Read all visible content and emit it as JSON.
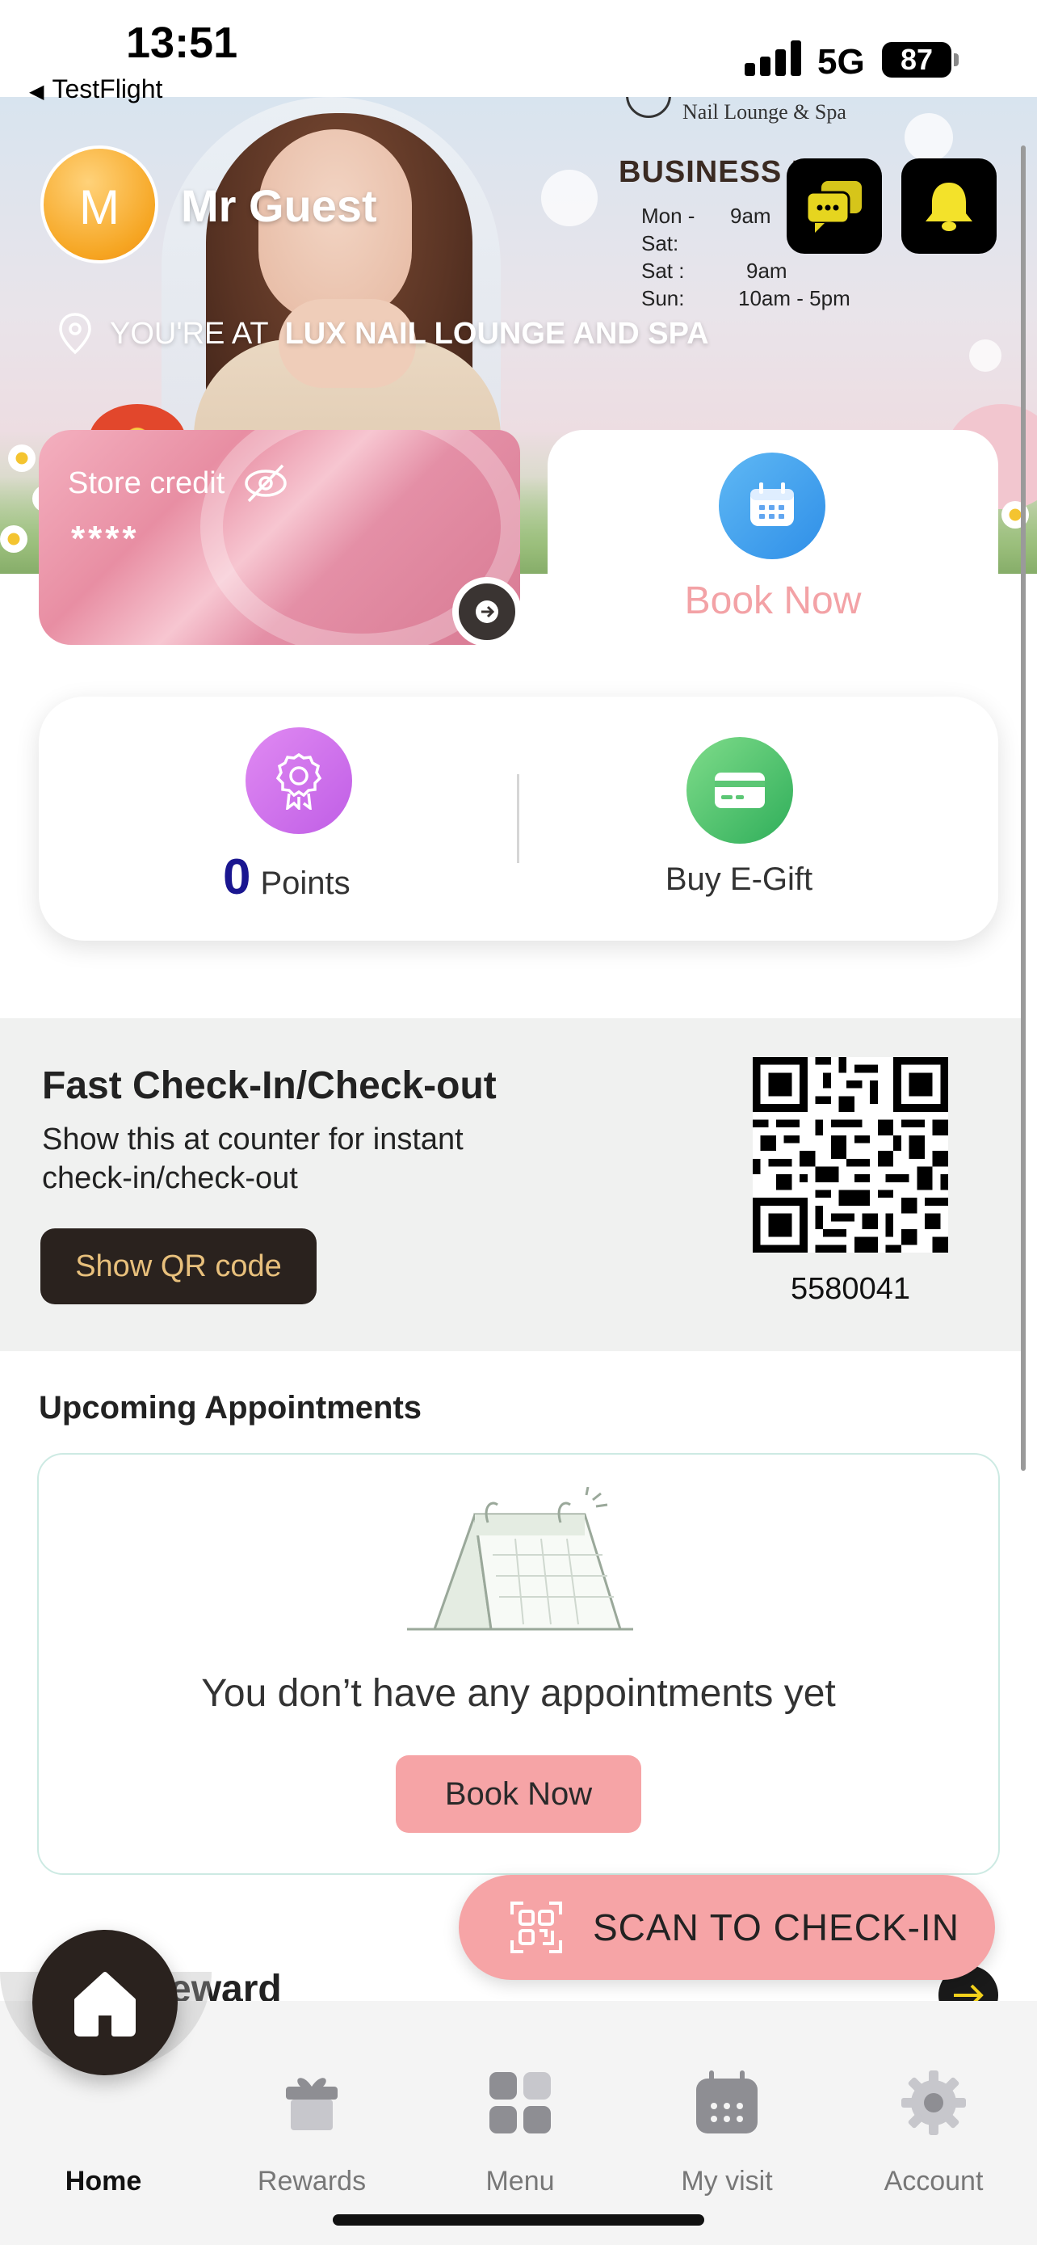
{
  "status_bar": {
    "time": "13:51",
    "back_app": "TestFlight",
    "network": "5G",
    "battery": "87"
  },
  "hero": {
    "brand_subtitle": "Nail Lounge & Spa",
    "hours_title": "BUSINESS H",
    "hours": [
      {
        "day": "Mon - Sat:",
        "time": "9am"
      },
      {
        "day": "Sat :",
        "time": "9am"
      },
      {
        "day": "Sun:",
        "time": "10am - 5pm"
      }
    ],
    "avatar_initial": "M",
    "user_name": "Mr Guest",
    "location_prefix": "YOU'RE AT",
    "location_name": "LUX NAIL LOUNGE AND SPA"
  },
  "store_credit": {
    "label": "Store credit",
    "value": "****"
  },
  "book_now_card": {
    "label": "Book Now"
  },
  "points": {
    "value": "0",
    "label": "Points"
  },
  "gift": {
    "label": "Buy E-Gift"
  },
  "checkin": {
    "title": "Fast Check-In/Check-out",
    "description": "Show this at counter for instant check-in/check-out",
    "button": "Show QR code",
    "code": "5580041"
  },
  "appointments": {
    "title": "Upcoming Appointments",
    "empty_message": "You don’t have any appointments yet",
    "book_button": "Book Now"
  },
  "reward_peek": "eward",
  "scan_button": "SCAN TO CHECK-IN",
  "tabs": [
    {
      "label": "Home",
      "icon": "home-icon"
    },
    {
      "label": "Rewards",
      "icon": "gift-box-icon"
    },
    {
      "label": "Menu",
      "icon": "grid-icon"
    },
    {
      "label": "My visit",
      "icon": "calendar-icon"
    },
    {
      "label": "Account",
      "icon": "gear-icon"
    }
  ],
  "colors": {
    "accent_pink": "#f6a4a6",
    "dark": "#2a221e",
    "points_number": "#1a1690"
  }
}
